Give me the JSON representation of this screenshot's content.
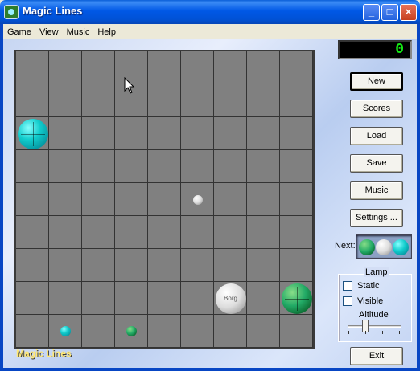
{
  "window": {
    "title": "Magic Lines",
    "icon": "magic-lines-app-icon",
    "controls": {
      "minimize": "_",
      "maximize": "□",
      "close": "×"
    }
  },
  "menu": {
    "items": [
      {
        "label": "Game"
      },
      {
        "label": "View"
      },
      {
        "label": "Music"
      },
      {
        "label": "Help"
      }
    ]
  },
  "board": {
    "grid": 9,
    "caption": "Magic Lines",
    "cell_color": "#808080",
    "balls": [
      {
        "row": 2,
        "col": 0,
        "color": "cyan",
        "size": "large"
      },
      {
        "row": 4,
        "col": 5,
        "color": "white",
        "size": "small"
      },
      {
        "row": 7,
        "col": 6,
        "color": "white",
        "size": "large",
        "text": "Borg"
      },
      {
        "row": 7,
        "col": 8,
        "color": "green",
        "size": "large"
      },
      {
        "row": 8,
        "col": 1,
        "color": "cyan",
        "size": "small"
      },
      {
        "row": 8,
        "col": 3,
        "color": "green",
        "size": "small"
      }
    ]
  },
  "score": {
    "value": "0",
    "color": "#14e614"
  },
  "buttons": {
    "new": "New",
    "scores": "Scores",
    "load": "Load",
    "save": "Save",
    "music": "Music",
    "settings": "Settings ...",
    "exit": "Exit"
  },
  "next": {
    "label": "Next:",
    "balls": [
      "green",
      "white",
      "cyan"
    ]
  },
  "lamp": {
    "title": "Lamp",
    "static_label": "Static",
    "static_checked": false,
    "visible_label": "Visible",
    "visible_checked": false,
    "altitude_label": "Altitude"
  },
  "colors": {
    "titlebar": "#0058e6",
    "cyan_ball": "#1cc",
    "green_ball": "#2a6",
    "white_ball": "#ddd"
  }
}
